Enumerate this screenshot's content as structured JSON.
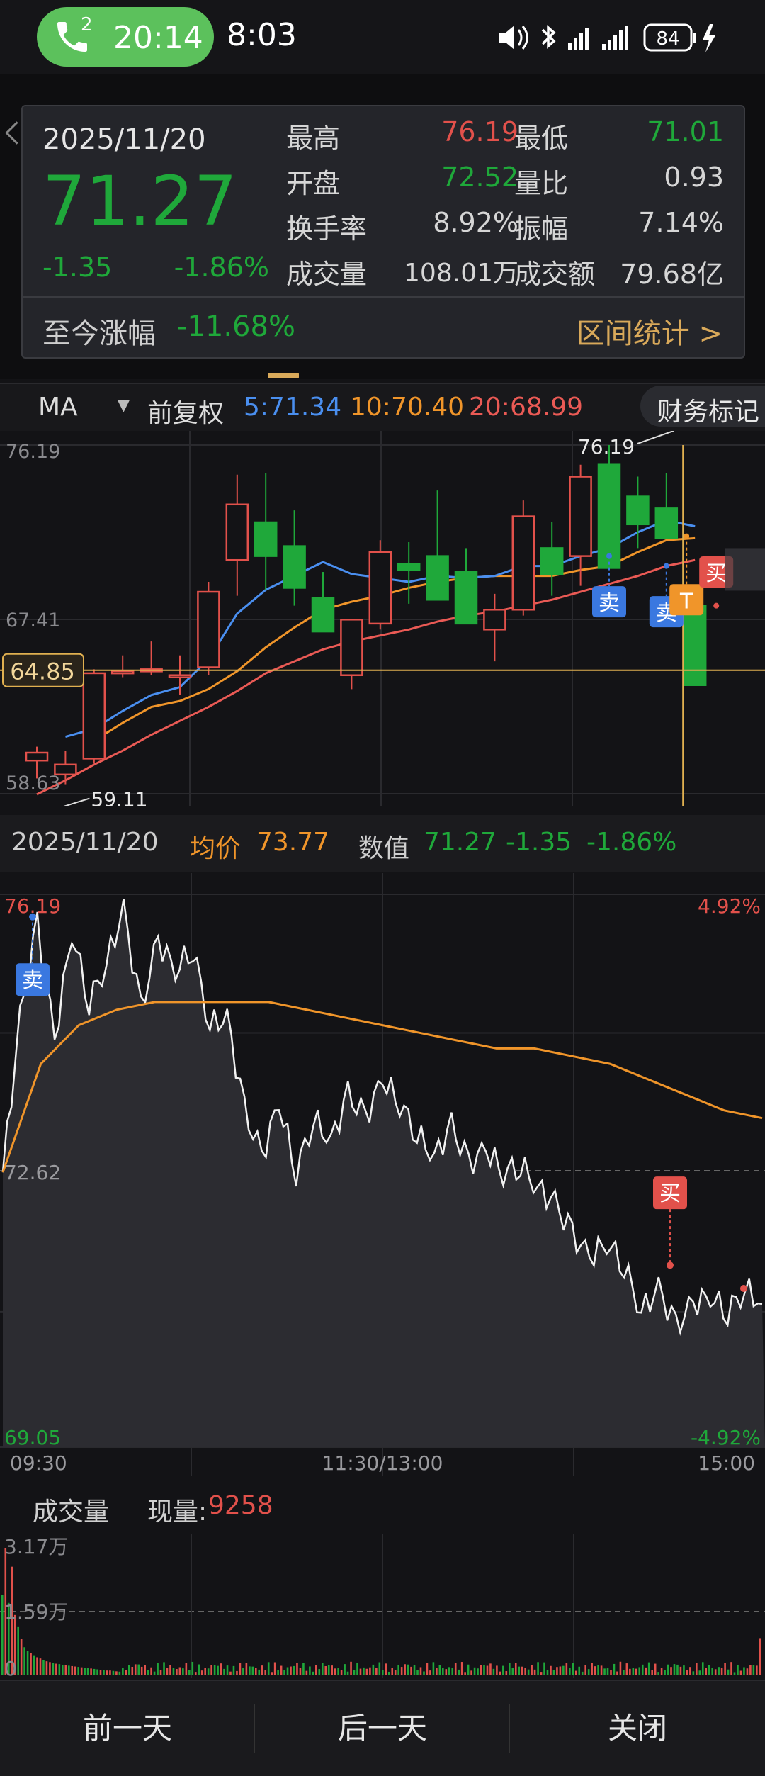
{
  "status_bar": {
    "call_badge": "2",
    "call_time": "20:14",
    "clock": "8:03",
    "battery": "84"
  },
  "popup": {
    "date": "2025/11/20",
    "price": "71.27",
    "change": "-1.35",
    "change_pct": "-1.86%",
    "rows": [
      {
        "l1": "最高",
        "v1": "76.19",
        "c1": "#e2514b",
        "l2": "最低",
        "v2": "71.01",
        "c2": "#1fa83a"
      },
      {
        "l1": "开盘",
        "v1": "72.52",
        "c1": "#1fa83a",
        "l2": "量比",
        "v2": "0.93",
        "c2": "#d6d6d6"
      },
      {
        "l1": "换手率",
        "v1": "8.92%",
        "c1": "#d6d6d6",
        "l2": "振幅",
        "v2": "7.14%",
        "c2": "#d6d6d6"
      },
      {
        "l1": "成交量",
        "v1": "108.01万",
        "c1": "#d6d6d6",
        "l2": "成交额",
        "v2": "79.68亿",
        "c2": "#d6d6d6"
      }
    ],
    "ytd_label": "至今涨幅",
    "ytd_value": "-11.68%",
    "stats_link": "区间统计 >"
  },
  "ma_bar": {
    "indicator": "MA",
    "adjust": "前复权",
    "ma5": "5:71.34",
    "ma10": "10:70.40",
    "ma20": "20:68.99",
    "finance": "财务标记",
    "colors": {
      "ma5": "#4a8ff0",
      "ma10": "#f0952a",
      "ma20": "#ea5a55"
    }
  },
  "kline": {
    "y_top_label": "76.19",
    "y_mid_label": "67.41",
    "y_bottom_label": "58.63",
    "crosshair_label": "64.85",
    "high_label": "76.19",
    "low_label": "59.11",
    "sell_badge": "卖",
    "buy_badge": "买",
    "t_badge": "T"
  },
  "intraday_bar": {
    "date": "2025/11/20",
    "avg_label": "均价",
    "avg_value": "73.77",
    "val_label": "数值",
    "val_price": "71.27",
    "val_change": "-1.35",
    "val_pct": "-1.86%"
  },
  "intraday": {
    "top_price": "76.19",
    "mid_price": "72.62",
    "bottom_price": "69.05",
    "top_pct": "4.92%",
    "bottom_pct": "-4.92%",
    "time_start": "09:30",
    "time_mid": "11:30/13:00",
    "time_end": "15:00",
    "sell_badge": "卖",
    "buy_badge": "买"
  },
  "volume": {
    "label": "成交量",
    "now_label": "现量:",
    "now_value": "9258",
    "max_label": "3.17万",
    "mid_label": "1.59万",
    "zero_label": "0"
  },
  "bottom_nav": {
    "prev": "前一天",
    "next": "后一天",
    "close": "关闭"
  },
  "chart_data": [
    {
      "type": "candlestick",
      "ylim": [
        58.63,
        76.19
      ],
      "y_ticks": [
        "76.19",
        "67.41",
        "58.63"
      ],
      "candles_ohlc": [
        [
          60.3,
          61.0,
          59.4,
          60.7
        ],
        [
          59.6,
          60.8,
          59.11,
          60.1
        ],
        [
          60.4,
          64.9,
          60.2,
          64.7
        ],
        [
          64.7,
          65.6,
          64.5,
          64.8
        ],
        [
          64.8,
          66.3,
          64.6,
          64.9
        ],
        [
          64.5,
          65.6,
          63.6,
          64.6
        ],
        [
          65.0,
          69.3,
          64.6,
          68.8
        ],
        [
          70.4,
          74.7,
          68.6,
          73.2
        ],
        [
          72.3,
          74.8,
          68.9,
          70.6
        ],
        [
          71.1,
          72.9,
          68.1,
          69.0
        ],
        [
          68.5,
          69.8,
          67.2,
          66.8
        ],
        [
          64.6,
          67.1,
          63.9,
          67.4
        ],
        [
          67.2,
          71.4,
          66.9,
          70.8
        ],
        [
          70.2,
          71.3,
          68.2,
          69.9
        ],
        [
          70.6,
          73.9,
          69.0,
          68.4
        ],
        [
          69.8,
          71.0,
          67.6,
          67.2
        ],
        [
          66.9,
          68.7,
          65.3,
          67.9
        ],
        [
          67.9,
          73.4,
          67.6,
          72.6
        ],
        [
          71.0,
          72.3,
          68.6,
          69.7
        ],
        [
          70.6,
          75.2,
          69.1,
          74.6
        ],
        [
          75.2,
          76.19,
          70.0,
          70.0
        ],
        [
          73.6,
          74.6,
          71.0,
          72.2
        ],
        [
          73.0,
          74.8,
          71.8,
          71.5
        ],
        [
          68.1,
          68.1,
          64.1,
          64.1
        ]
      ],
      "ma5": [
        null,
        61.5,
        61.9,
        62.8,
        63.6,
        64.0,
        65.4,
        67.7,
        68.9,
        69.6,
        70.3,
        69.7,
        69.5,
        69.3,
        69.6,
        69.5,
        69.6,
        70.1,
        70.1,
        70.6,
        71.0,
        71.8,
        72.4,
        72.1
      ],
      "ma10": [
        null,
        null,
        61.3,
        62.2,
        63.0,
        63.3,
        63.9,
        64.8,
        66.0,
        67.0,
        67.9,
        68.3,
        68.6,
        69.0,
        69.3,
        69.5,
        69.6,
        69.6,
        69.6,
        69.9,
        70.1,
        70.8,
        71.4,
        71.5
      ],
      "ma20": [
        58.6,
        59.3,
        60.1,
        60.8,
        61.6,
        62.3,
        63.0,
        63.8,
        64.7,
        65.3,
        65.9,
        66.3,
        66.6,
        66.9,
        67.3,
        67.6,
        67.8,
        68.1,
        68.4,
        68.8,
        69.2,
        69.6,
        70.1,
        70.4
      ]
    },
    {
      "type": "line",
      "title": "",
      "ylim": [
        69.05,
        76.19
      ],
      "reference": 72.62,
      "x_ticks": [
        "09:30",
        "11:30/13:00",
        "15:00"
      ],
      "series": [
        {
          "name": "",
          "values": [
            72.6,
            74.6,
            75.8,
            74.3,
            75.7,
            74.8,
            75.3,
            76.0,
            74.7,
            75.6,
            75.2,
            75.5,
            74.5,
            74.6,
            73.4,
            72.8,
            73.5,
            72.6,
            73.3,
            73.0,
            73.6,
            73.3,
            73.8,
            73.5,
            73.1,
            72.8,
            73.2,
            72.7,
            72.9,
            72.6,
            72.7,
            72.4,
            72.2,
            71.8,
            71.5,
            71.7,
            71.4,
            70.8,
            71.1,
            70.6,
            70.9,
            71.0,
            70.8,
            71.1,
            70.9
          ]
        },
        {
          "name": "均价",
          "values": [
            72.6,
            74.0,
            74.5,
            74.7,
            74.8,
            74.8,
            74.8,
            74.8,
            74.7,
            74.6,
            74.5,
            74.4,
            74.3,
            74.2,
            74.2,
            74.1,
            74.0,
            73.8,
            73.6,
            73.4,
            73.3
          ]
        }
      ]
    },
    {
      "type": "bar",
      "title": "成交量",
      "ylim": [
        0,
        31700
      ],
      "y_ticks": [
        "3.17万",
        "1.59万",
        "0"
      ],
      "values": [
        20000,
        31700,
        18000,
        27000,
        15000,
        12000,
        9000,
        7000,
        6000,
        5500,
        5000,
        4500,
        4200,
        3800,
        3500,
        3300,
        3100,
        2900,
        2800,
        2600,
        2500,
        2400,
        2300,
        2200,
        2100,
        2000,
        1900,
        1800,
        1700,
        1600,
        1500,
        1400,
        1300,
        1200,
        1200,
        1100,
        1000,
        9258
      ]
    }
  ]
}
